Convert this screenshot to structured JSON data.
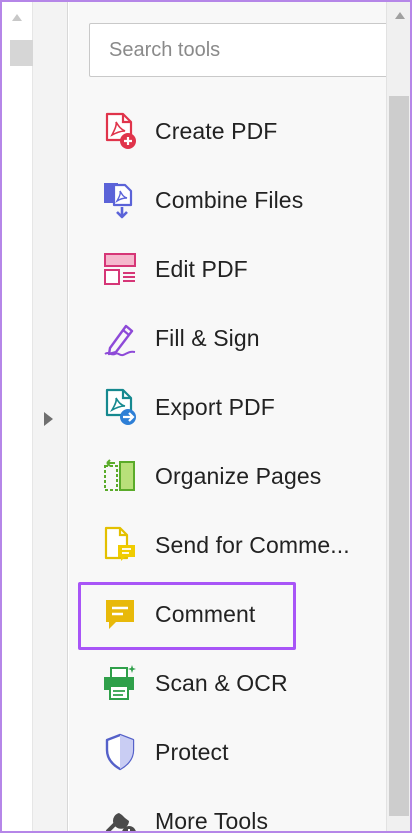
{
  "search": {
    "placeholder": "Search tools"
  },
  "tools": [
    {
      "label": "Create PDF",
      "icon": "create-pdf-icon",
      "color": "#e0344b"
    },
    {
      "label": "Combine Files",
      "icon": "combine-files-icon",
      "color": "#5b63d8"
    },
    {
      "label": "Edit PDF",
      "icon": "edit-pdf-icon",
      "color": "#d63677"
    },
    {
      "label": "Fill & Sign",
      "icon": "fill-sign-icon",
      "color": "#8e4ad8"
    },
    {
      "label": "Export PDF",
      "icon": "export-pdf-icon",
      "color": "#16898f"
    },
    {
      "label": "Organize Pages",
      "icon": "organize-pages-icon",
      "color": "#5aab2a"
    },
    {
      "label": "Send for Comme...",
      "icon": "send-for-comment-icon",
      "color": "#e3c000"
    },
    {
      "label": "Comment",
      "icon": "comment-icon",
      "color": "#e3b400"
    },
    {
      "label": "Scan & OCR",
      "icon": "scan-ocr-icon",
      "color": "#2fa04a"
    },
    {
      "label": "Protect",
      "icon": "protect-icon",
      "color": "#5561c9"
    },
    {
      "label": "More Tools",
      "icon": "more-tools-icon",
      "color": "#4b4b4b"
    }
  ],
  "highlighted_tool": "Comment",
  "colors": {
    "highlight_border": "#a855f7",
    "frame_border": "#b586e8"
  }
}
